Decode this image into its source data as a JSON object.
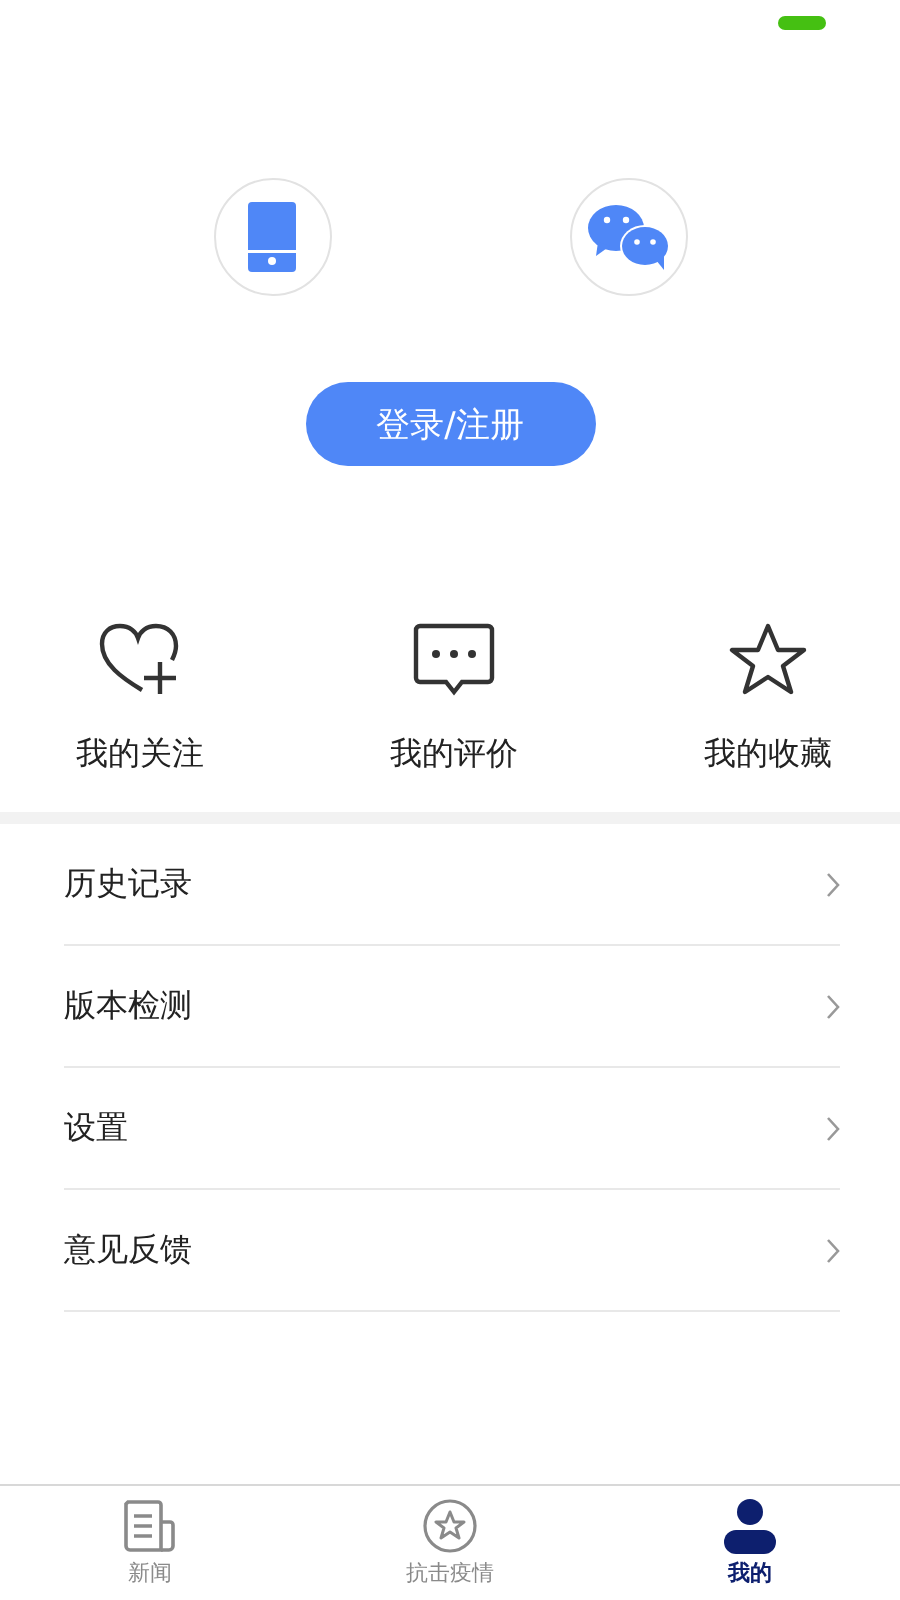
{
  "login": {
    "methods": [
      {
        "kind": "phone"
      },
      {
        "kind": "wechat"
      }
    ],
    "button": "登录/注册"
  },
  "shortcuts": [
    {
      "kind": "heart",
      "label": "我的关注"
    },
    {
      "kind": "comment",
      "label": "我的评价"
    },
    {
      "kind": "star",
      "label": "我的收藏"
    }
  ],
  "menu": [
    {
      "label": "历史记录"
    },
    {
      "label": "版本检测"
    },
    {
      "label": "设置"
    },
    {
      "label": "意见反馈"
    }
  ],
  "tabs": [
    {
      "kind": "news",
      "label": "新闻",
      "selected": false
    },
    {
      "kind": "epidemic",
      "label": "抗击疫情",
      "selected": false
    },
    {
      "kind": "me",
      "label": "我的",
      "selected": true
    }
  ]
}
